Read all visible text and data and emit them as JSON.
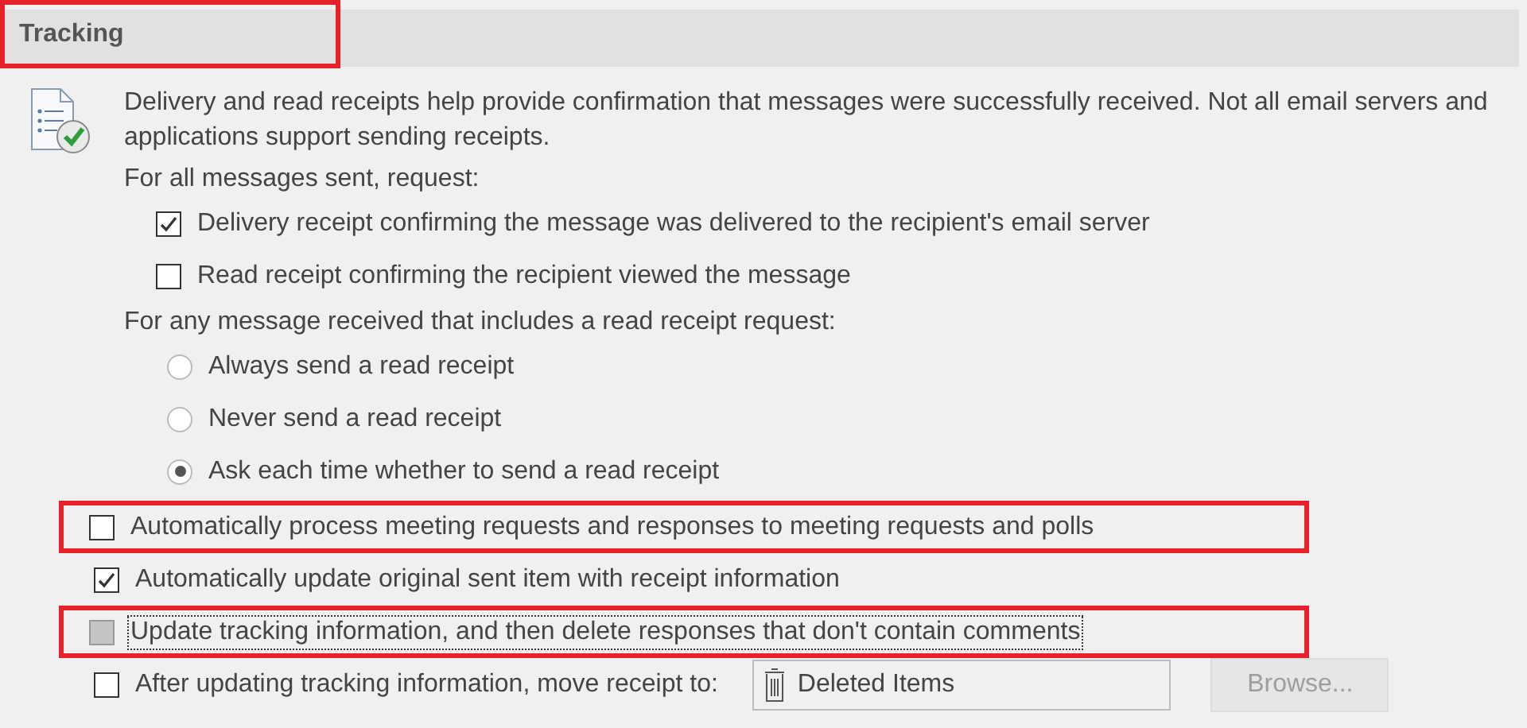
{
  "section": {
    "title": "Tracking",
    "highlighted": true
  },
  "description": "Delivery and read receipts help provide confirmation that messages were successfully received. Not all email servers and applications support sending receipts.",
  "groups": [
    {
      "label": "For all messages sent, request:",
      "kind": "checkbox",
      "options": [
        {
          "label": "Delivery receipt confirming the message was delivered to the recipient's email server",
          "checked": true
        },
        {
          "label": "Read receipt confirming the recipient viewed the message",
          "checked": false
        }
      ]
    },
    {
      "label": "For any message received that includes a read receipt request:",
      "kind": "radio",
      "options": [
        {
          "label": "Always send a read receipt",
          "selected": false
        },
        {
          "label": "Never send a read receipt",
          "selected": false
        },
        {
          "label": "Ask each time whether to send a read receipt",
          "selected": true
        }
      ]
    }
  ],
  "options": [
    {
      "label": "Automatically process meeting requests and responses to meeting requests and polls",
      "checked": false,
      "disabled": false,
      "focused": false,
      "highlighted": true
    },
    {
      "label": "Automatically update original sent item with receipt information",
      "checked": true,
      "disabled": false,
      "focused": false,
      "highlighted": false
    },
    {
      "label": "Update tracking information, and then delete responses that don't contain comments",
      "checked": false,
      "disabled": true,
      "focused": true,
      "highlighted": true
    }
  ],
  "move_receipt": {
    "label": "After updating tracking information, move receipt to:",
    "checked": false,
    "folder": "Deleted Items",
    "button": {
      "label": "Browse...",
      "disabled": true
    }
  }
}
